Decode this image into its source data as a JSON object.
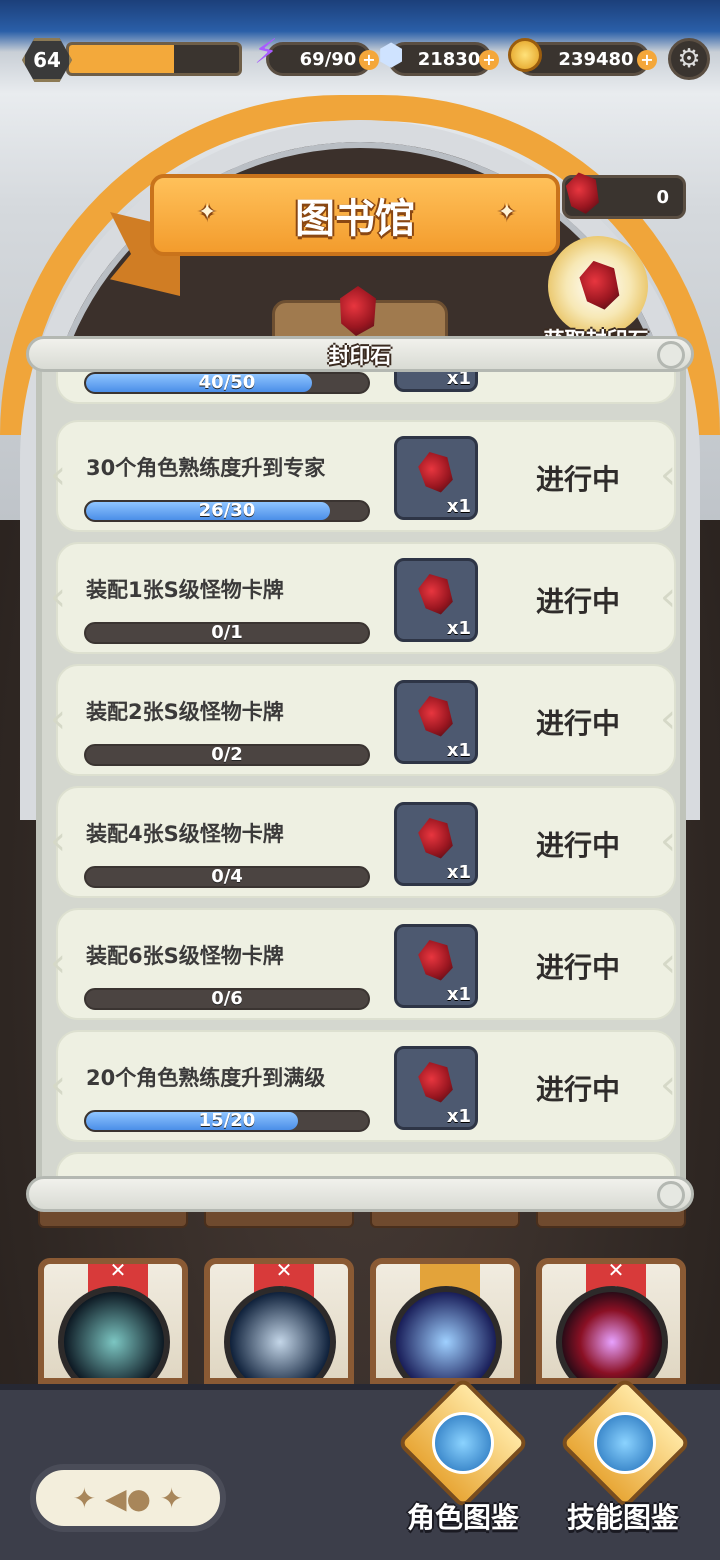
{
  "topbar": {
    "level": "64",
    "xp_fraction": 0.62,
    "energy": "69/90",
    "diamonds": "21830",
    "gold": "239480",
    "plus": "+"
  },
  "header": {
    "title": "图书馆",
    "seal_stone_count": "0",
    "get_seal_label": "获取封印石",
    "seal_tab_label": "封印石"
  },
  "quests": [
    {
      "title": "",
      "progress": "40/50",
      "fraction": 0.8,
      "reward_qty": "x1",
      "status": ""
    },
    {
      "title": "30个角色熟练度升到专家",
      "progress": "26/30",
      "fraction": 0.867,
      "reward_qty": "x1",
      "status": "进行中"
    },
    {
      "title": "装配1张S级怪物卡牌",
      "progress": "0/1",
      "fraction": 0,
      "reward_qty": "x1",
      "status": "进行中"
    },
    {
      "title": "装配2张S级怪物卡牌",
      "progress": "0/2",
      "fraction": 0,
      "reward_qty": "x1",
      "status": "进行中"
    },
    {
      "title": "装配4张S级怪物卡牌",
      "progress": "0/4",
      "fraction": 0,
      "reward_qty": "x1",
      "status": "进行中"
    },
    {
      "title": "装配6张S级怪物卡牌",
      "progress": "0/6",
      "fraction": 0,
      "reward_qty": "x1",
      "status": "进行中"
    },
    {
      "title": "20个角色熟练度升到满级",
      "progress": "15/20",
      "fraction": 0.75,
      "reward_qty": "x1",
      "status": "进行中"
    }
  ],
  "bottom": {
    "character_codex": "角色图鉴",
    "skill_codex": "技能图鉴"
  },
  "colors": {
    "accent_orange": "#f39c2d",
    "progress_blue": "#4b8ee8",
    "row_bg": "#eef0e2"
  }
}
